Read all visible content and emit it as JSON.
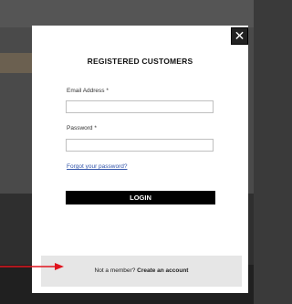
{
  "modal": {
    "title": "REGISTERED CUSTOMERS",
    "close_icon": "close-icon",
    "email": {
      "label": "Email Address *",
      "value": "",
      "placeholder": ""
    },
    "password": {
      "label": "Password *",
      "value": "",
      "placeholder": ""
    },
    "forgot_link": "Forgot your password?",
    "login_button": "LOGIN",
    "footer": {
      "prompt": "Not a member?",
      "create_link": "Create an account"
    }
  },
  "annotation": {
    "arrow_color": "#e0141e",
    "icon": "arrow-right-icon"
  }
}
